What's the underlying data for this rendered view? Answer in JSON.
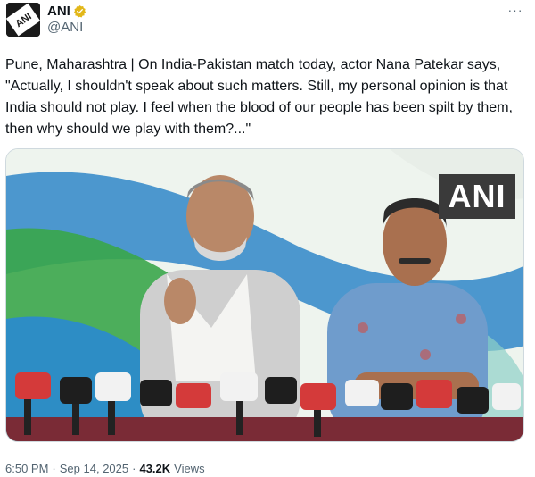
{
  "account": {
    "display_name": "ANI",
    "handle": "@ANI",
    "avatar_logo_text": "ANI",
    "verified": true,
    "verified_color": "#e2b719"
  },
  "more_label": "···",
  "tweet": {
    "text": "Pune, Maharashtra | On India-Pakistan match today, actor Nana Patekar says, \"Actually, I shouldn't speak about such matters. Still, my personal opinion is that India should not play. I feel when the blood of our people has been spilt by them, then why should we play with them?...\""
  },
  "media": {
    "watermark": "ANI"
  },
  "meta": {
    "time": "6:50 PM",
    "separator1": "·",
    "date": "Sep 14, 2025",
    "separator2": "·",
    "views_count": "43.2K",
    "views_label": "Views"
  },
  "icons": {
    "verified": "verified-badge-icon",
    "more": "more-options-icon"
  }
}
